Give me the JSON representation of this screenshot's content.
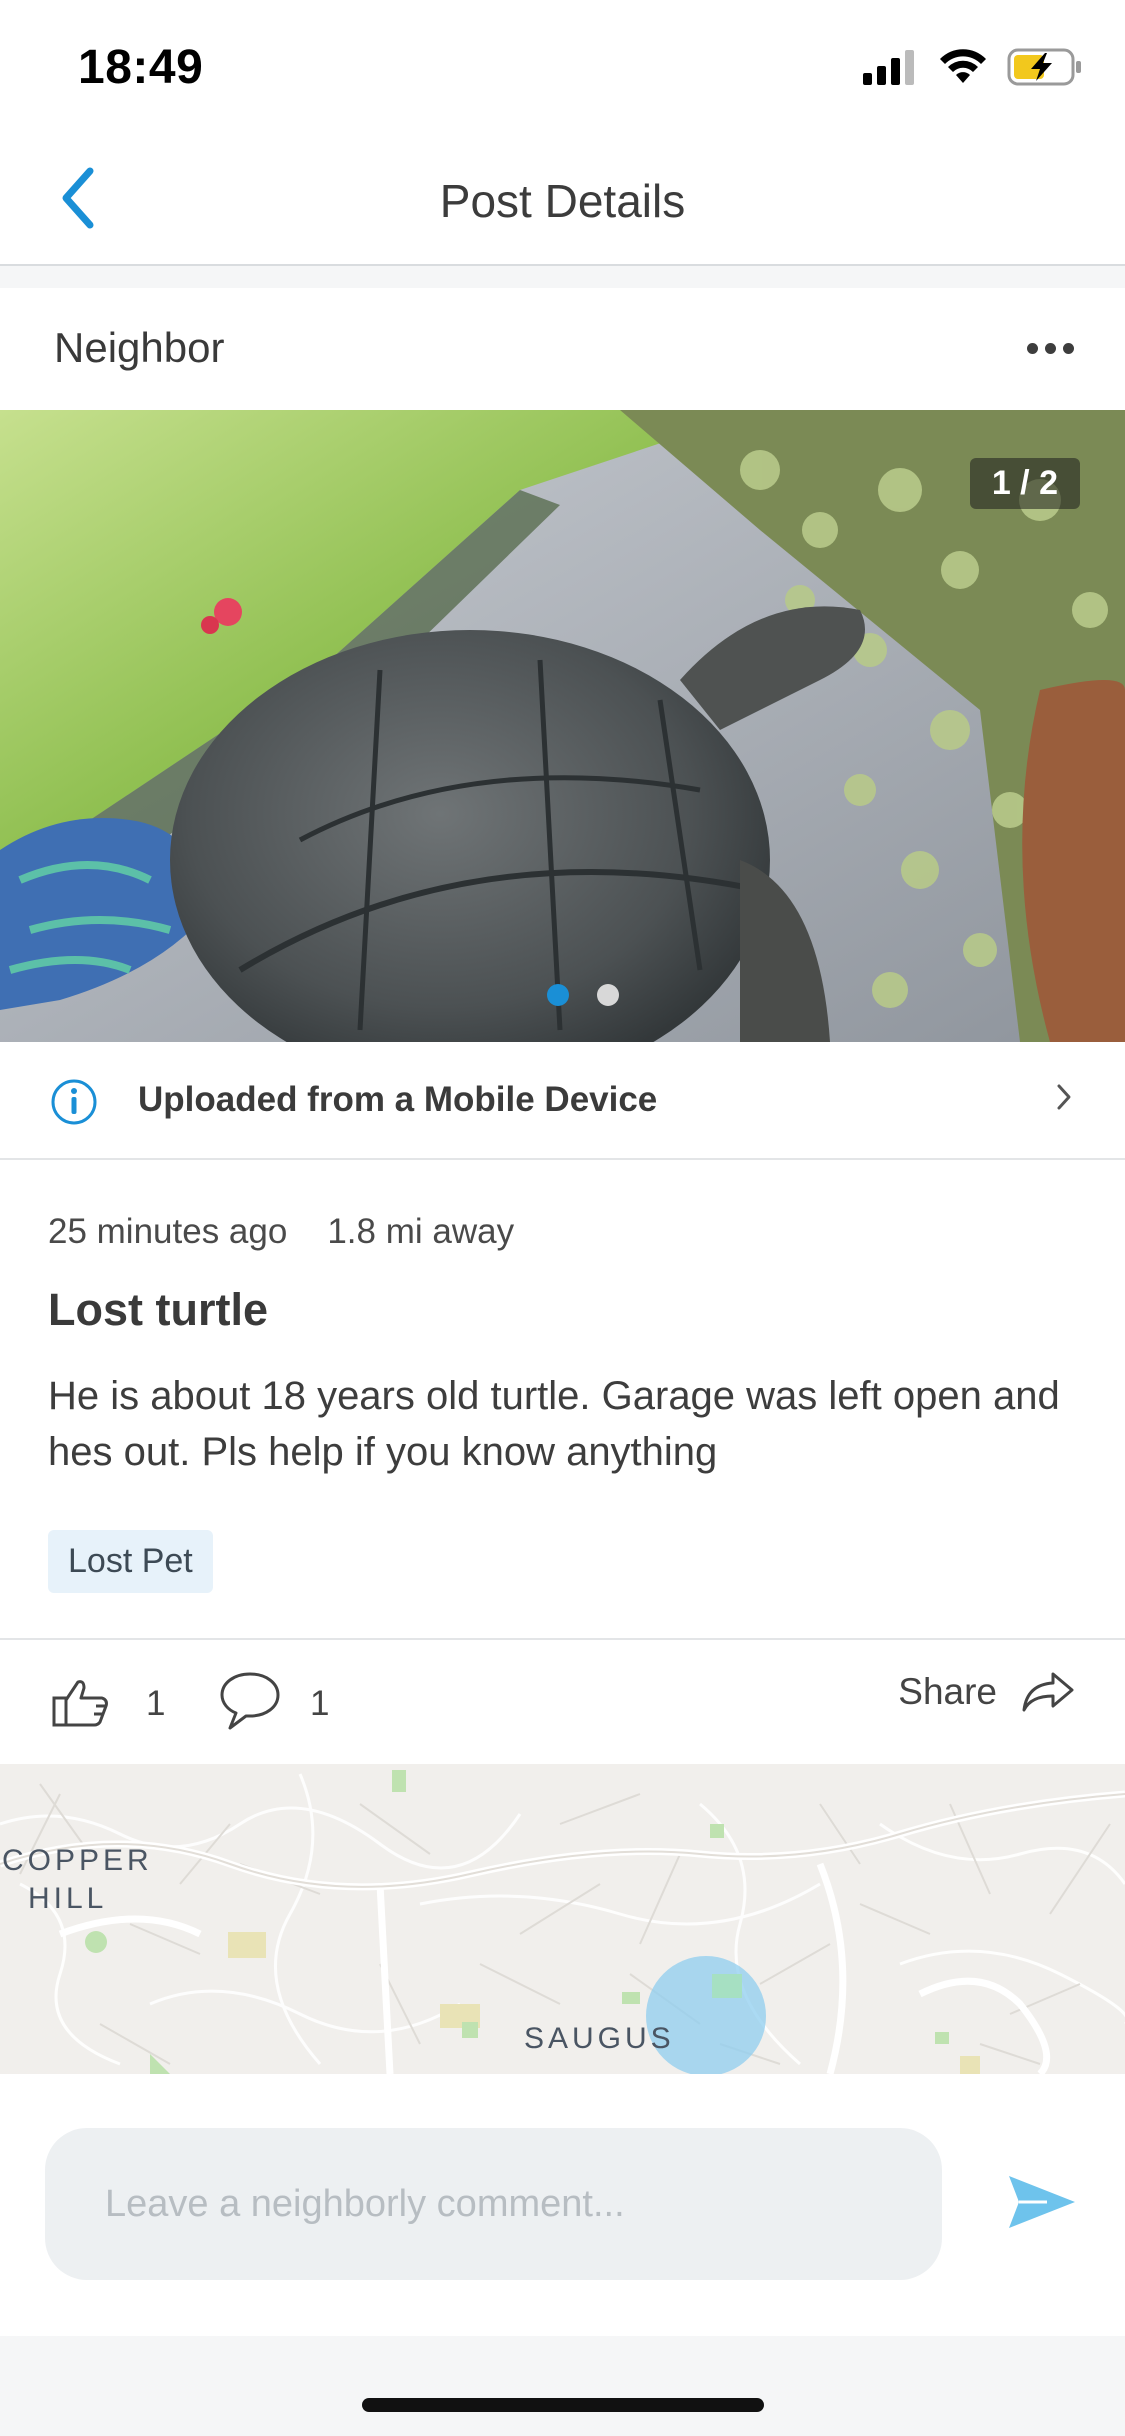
{
  "status_bar": {
    "time": "18:49",
    "icons": [
      "cellular-signal-icon",
      "wifi-icon",
      "battery-charging-icon"
    ]
  },
  "nav": {
    "title": "Post Details",
    "back_icon": "chevron-left-icon"
  },
  "post": {
    "author": "Neighbor",
    "more_icon": "ellipsis-icon",
    "photo": {
      "counter": "1 / 2",
      "current_index": 1,
      "total": 2
    },
    "upload_source": "Uploaded from a Mobile Device",
    "time_ago": "25 minutes ago",
    "distance": "1.8 mi away",
    "title": "Lost turtle",
    "body": "He is about 18 years old turtle. Garage was left open and hes out. Pls help if you know anything",
    "tag": "Lost Pet"
  },
  "actions": {
    "like_count": "1",
    "comment_count": "1",
    "share_label": "Share"
  },
  "map": {
    "labels": {
      "copper_line1": "COPPER",
      "copper_line2": "HILL",
      "saugus": "SAUGUS"
    }
  },
  "composer": {
    "placeholder": "Leave a neighborly comment...",
    "value": ""
  },
  "colors": {
    "accent": "#1a8fd6",
    "send": "#6ec3ec",
    "tag_bg": "#e7f2fa",
    "input_bg": "#edf0f2"
  }
}
